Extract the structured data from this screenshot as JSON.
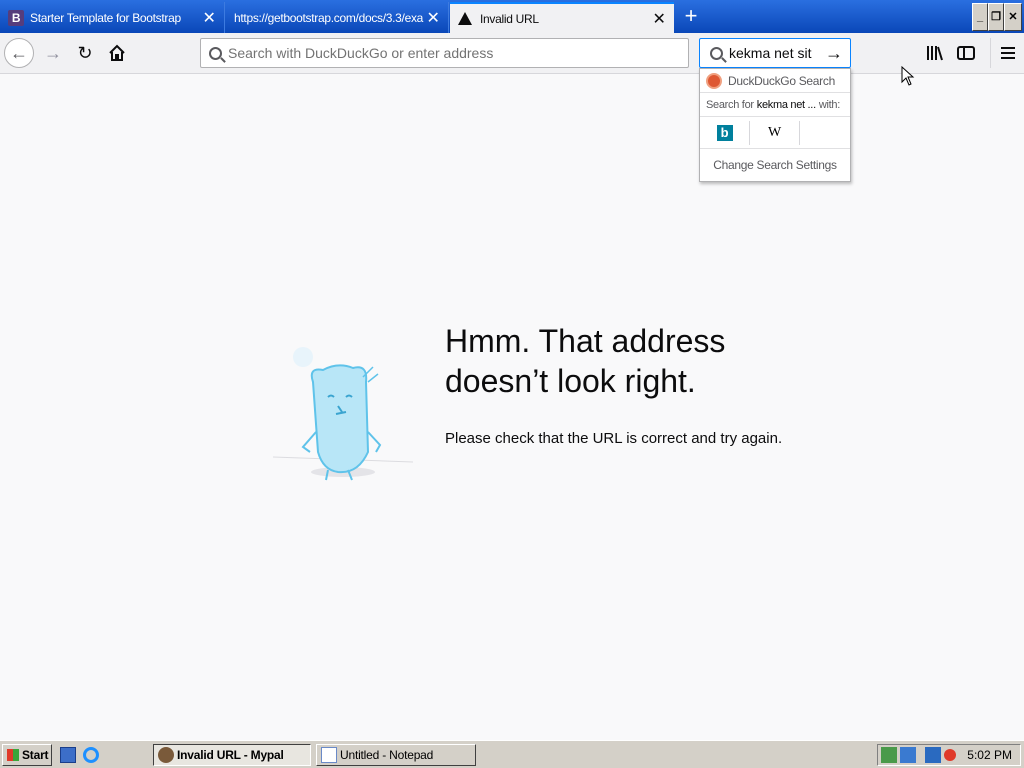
{
  "tabs": [
    {
      "title": "Starter Template for Bootstrap",
      "favicon": "B"
    },
    {
      "title": "https://getbootstrap.com/docs/3.3/exa"
    },
    {
      "title": "Invalid URL"
    }
  ],
  "window": {
    "minimize": "_",
    "restore": "❐"
  },
  "toolbar": {
    "back": "←",
    "forward": "→",
    "reload": "↻",
    "url_placeholder": "Search with DuckDuckGo or enter address",
    "search_value": "kekma net sit",
    "go": "→"
  },
  "search_popup": {
    "engine_name": "DuckDuckGo Search",
    "search_for_prefix": "Search for",
    "search_for_term": "kekma net ...",
    "search_for_suffix": "with:",
    "bing": "b",
    "wiki": "W",
    "change_settings": "Change Search Settings"
  },
  "error": {
    "title": "Hmm. That address doesn’t look right.",
    "description": "Please check that the URL is correct and try again."
  },
  "taskbar": {
    "start": "Start",
    "task1": "Invalid URL - Mypal",
    "task2": "Untitled - Notepad",
    "clock": "5:02 PM"
  },
  "colors": {
    "titlebar": "#0a54c8",
    "accent": "#0a84ff",
    "content_bg": "#f9f9fa",
    "taskbar": "#d4d0c8"
  }
}
